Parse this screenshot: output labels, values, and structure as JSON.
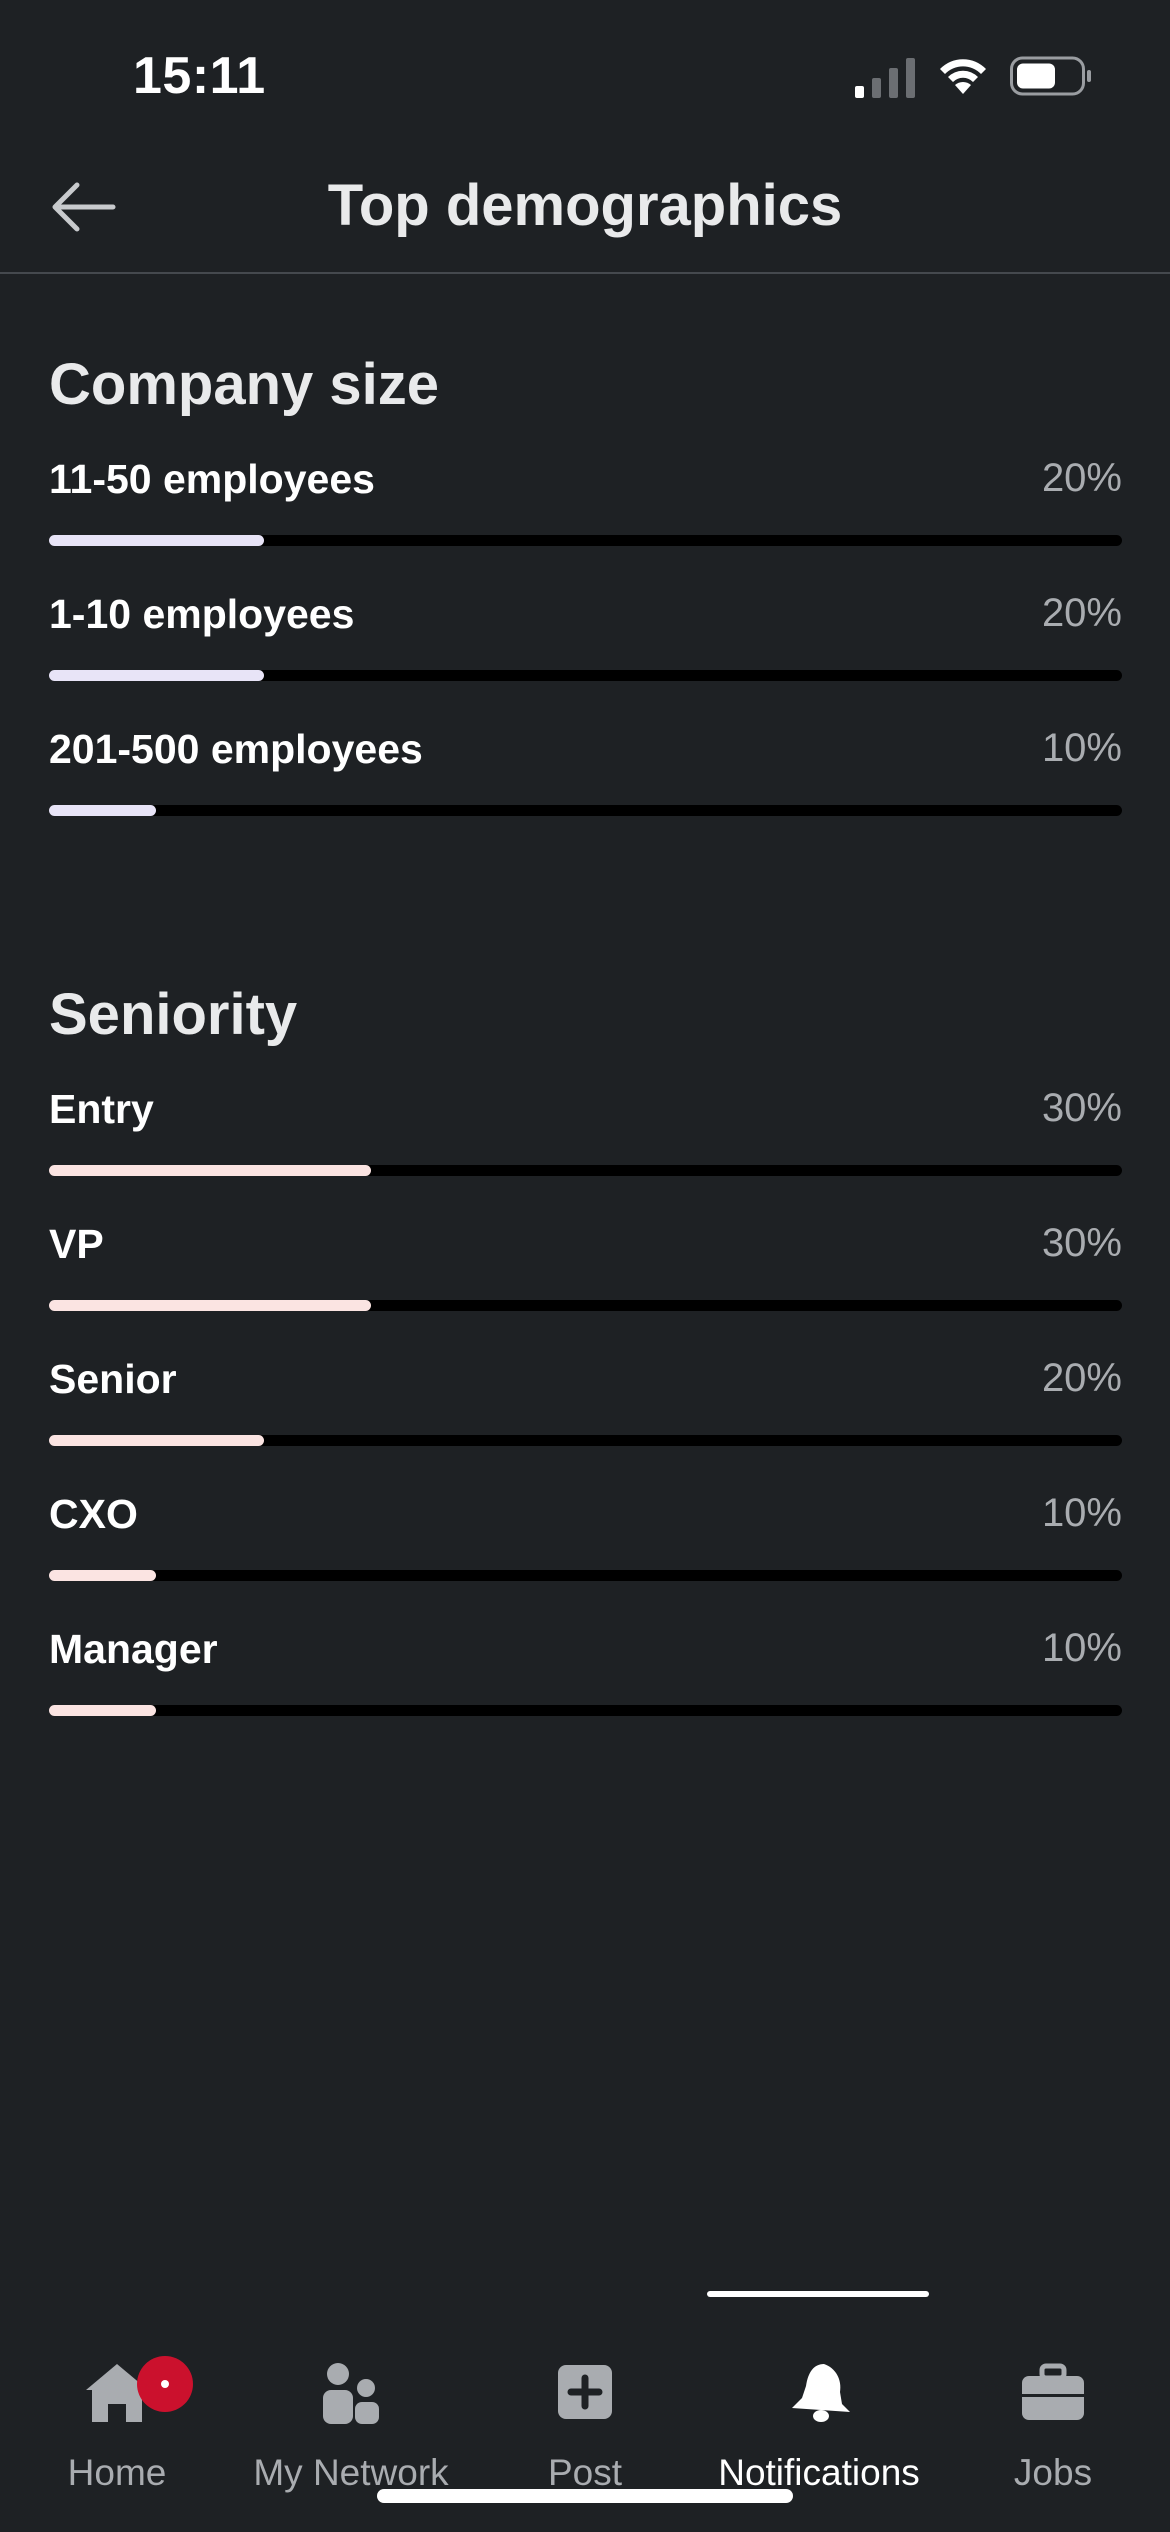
{
  "status_bar": {
    "time": "15:11",
    "icons": [
      "cellular-signal-icon",
      "wifi-icon",
      "battery-icon"
    ]
  },
  "header": {
    "title": "Top demographics",
    "back_icon": "arrow-left-icon"
  },
  "sections": [
    {
      "title": "Company size",
      "bar_color": "#e8e4f7",
      "rows": [
        {
          "label": "11-50 employees",
          "value": "20%",
          "fraction": 0.2
        },
        {
          "label": "1-10 employees",
          "value": "20%",
          "fraction": 0.2
        },
        {
          "label": "201-500 employees",
          "value": "10%",
          "fraction": 0.1
        }
      ]
    },
    {
      "title": "Seniority",
      "bar_color": "#fbe4e2",
      "rows": [
        {
          "label": "Entry",
          "value": "30%",
          "fraction": 0.3
        },
        {
          "label": "VP",
          "value": "30%",
          "fraction": 0.3
        },
        {
          "label": "Senior",
          "value": "20%",
          "fraction": 0.2
        },
        {
          "label": "CXO",
          "value": "10%",
          "fraction": 0.1
        },
        {
          "label": "Manager",
          "value": "10%",
          "fraction": 0.1
        }
      ]
    }
  ],
  "bottom_nav": {
    "items": [
      {
        "label": "Home",
        "icon": "home-icon",
        "badge": true
      },
      {
        "label": "My Network",
        "icon": "people-icon"
      },
      {
        "label": "Post",
        "icon": "plus-square-icon"
      },
      {
        "label": "Notifications",
        "icon": "bell-icon",
        "active": true
      },
      {
        "label": "Jobs",
        "icon": "briefcase-icon"
      }
    ]
  },
  "colors": {
    "background": "#1e2124",
    "track": "#000000",
    "badge": "#cb112d",
    "muted_text": "#a9acb0"
  }
}
